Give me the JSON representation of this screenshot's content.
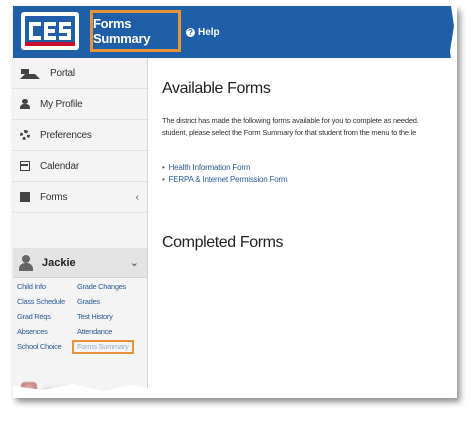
{
  "header": {
    "tab_label": "Forms Summary",
    "help_label": "Help",
    "help_icon_glyph": "?"
  },
  "sidebar": {
    "items": [
      {
        "label": "Portal",
        "icon": "home-icon"
      },
      {
        "label": "My Profile",
        "icon": "user-icon"
      },
      {
        "label": "Preferences",
        "icon": "gear-icon"
      },
      {
        "label": "Calendar",
        "icon": "calendar-icon"
      },
      {
        "label": "Forms",
        "icon": "document-icon",
        "chevron": "‹"
      }
    ],
    "student": {
      "name": "Jackie",
      "chevron": "⌄"
    },
    "student_links": [
      "Child Info",
      "Grade Changes",
      "Class Schedule",
      "Grades",
      "Grad Reqs",
      "Test History",
      "Absences",
      "Attendance",
      "School Choice",
      "Forms Summary"
    ],
    "second_student": {
      "name_tail": "n",
      "chevron": "‹"
    }
  },
  "main": {
    "available_title": "Available Forms",
    "intro_line1": "The district has made the following forms available for you to complete as needed.",
    "intro_line2": "student, please select the Form Summary for that student from the menu to the le",
    "forms": [
      "Health Information Form",
      "FERPA & Internet Permission Form"
    ],
    "completed_title": "Completed Forms"
  },
  "colors": {
    "header_blue": "#1f5fa8",
    "highlight_orange": "#e8923a",
    "link_blue": "#2c5d9a"
  }
}
